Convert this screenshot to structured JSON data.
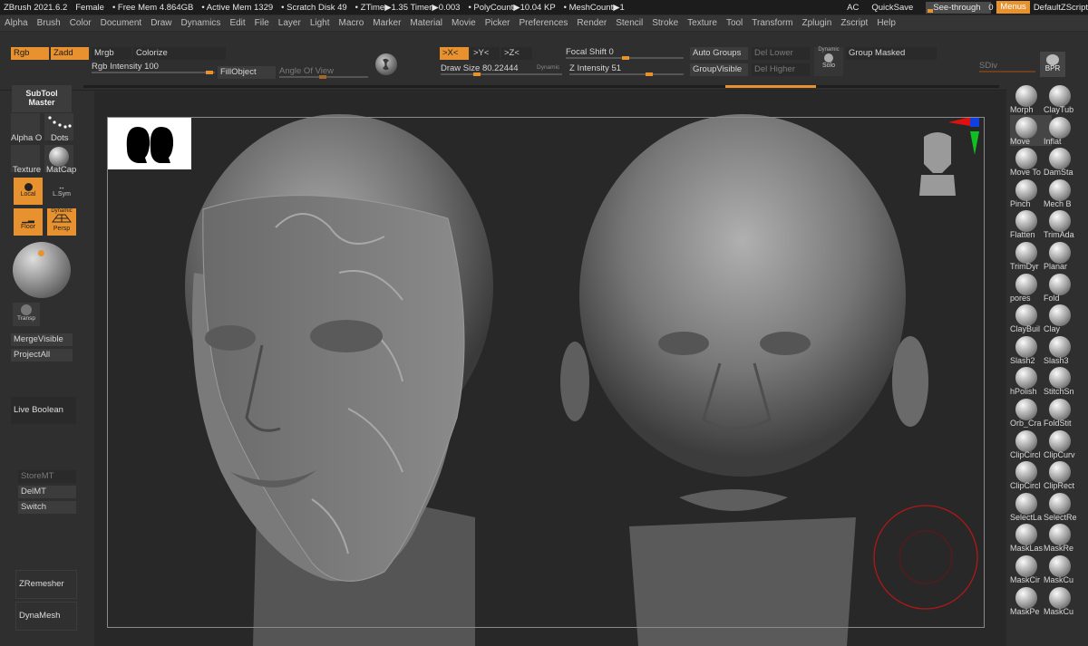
{
  "titlebar": {
    "items": [
      "ZBrush 2021.6.2",
      "Female",
      "• Free Mem 4.864GB",
      "• Active Mem 1329",
      "• Scratch Disk 49",
      "• ZTime▶1.35 Timer▶0.003",
      "• PolyCount▶10.04 KP",
      "• MeshCount▶1"
    ],
    "ac": "AC",
    "quicksave": "QuickSave",
    "seethrough": "See-through",
    "seethrough_value": "0",
    "menus": "Menus",
    "script": "DefaultZScript"
  },
  "menubar": [
    "Alpha",
    "Brush",
    "Color",
    "Document",
    "Draw",
    "Dynamics",
    "Edit",
    "File",
    "Layer",
    "Light",
    "Macro",
    "Marker",
    "Material",
    "Movie",
    "Picker",
    "Preferences",
    "Render",
    "Stencil",
    "Stroke",
    "Texture",
    "Tool",
    "Transform",
    "Zplugin",
    "Zscript",
    "Help"
  ],
  "shelf": {
    "rgb": "Rgb",
    "zadd": "Zadd",
    "mrgb": "Mrgb",
    "colorize": "Colorize",
    "rgb_intensity_label": "Rgb Intensity",
    "rgb_intensity": "100",
    "fillobject": "FillObject",
    "angle_of_view": "Angle Of View",
    "x_sym": ">X<",
    "y_sym": ">Y<",
    "z_sym": ">Z<",
    "draw_size_label": "Draw Size",
    "draw_size": "80.22444",
    "dynamic": "Dynamic",
    "focal_shift_label": "Focal Shift",
    "focal_shift": "0",
    "z_intensity_label": "Z Intensity",
    "z_intensity": "51",
    "auto_groups": "Auto Groups",
    "group_visible": "GroupVisible",
    "del_lower": "Del Lower",
    "del_higher": "Del Higher",
    "solo_dynamic": "Dynamic",
    "solo": "Solo",
    "group_masked": "Group Masked",
    "sdiv": "SDiv",
    "bpr": "BPR"
  },
  "left": {
    "subtool_master": "SubTool Master",
    "alpha": "Alpha O",
    "dots": "Dots",
    "texture": "Texture",
    "matcap": "MatCap",
    "local": "Local",
    "lsym": "L.Sym",
    "floor": "Floor",
    "persp_dynamic": "Dynamic",
    "persp": "Persp",
    "transp": "Transp",
    "merge_visible": "MergeVisible",
    "project_all": "ProjectAll",
    "live_boolean": "Live Boolean",
    "store_mt": "StoreMT",
    "del_mt": "DelMT",
    "switch": "Switch",
    "zremesher": "ZRemesher",
    "dynamesh": "DynaMesh"
  },
  "brushes": [
    "Morph",
    "ClayTub",
    "Move",
    "Inflat",
    "Move To",
    "DamSta",
    "Pinch",
    "Mech B",
    "Flatten",
    "TrimAda",
    "TrimDyr",
    "Planar",
    "pores",
    "Fold",
    "ClayBuil",
    "Clay",
    "Slash2",
    "Slash3",
    "hPolish",
    "StitchSn",
    "Orb_Cra",
    "FoldStit",
    "ClipCircl",
    "ClipCurv",
    "ClipCircl",
    "ClipRect",
    "SelectLa",
    "SelectRe",
    "MaskLas",
    "MaskRe",
    "MaskCir",
    "MaskCu",
    "MaskPe",
    "MaskCu"
  ],
  "colors": {
    "accent": "#e8922f",
    "bg": "#2b2b2b",
    "panel": "#2f2f2f",
    "brush_ring": "#b01818"
  }
}
